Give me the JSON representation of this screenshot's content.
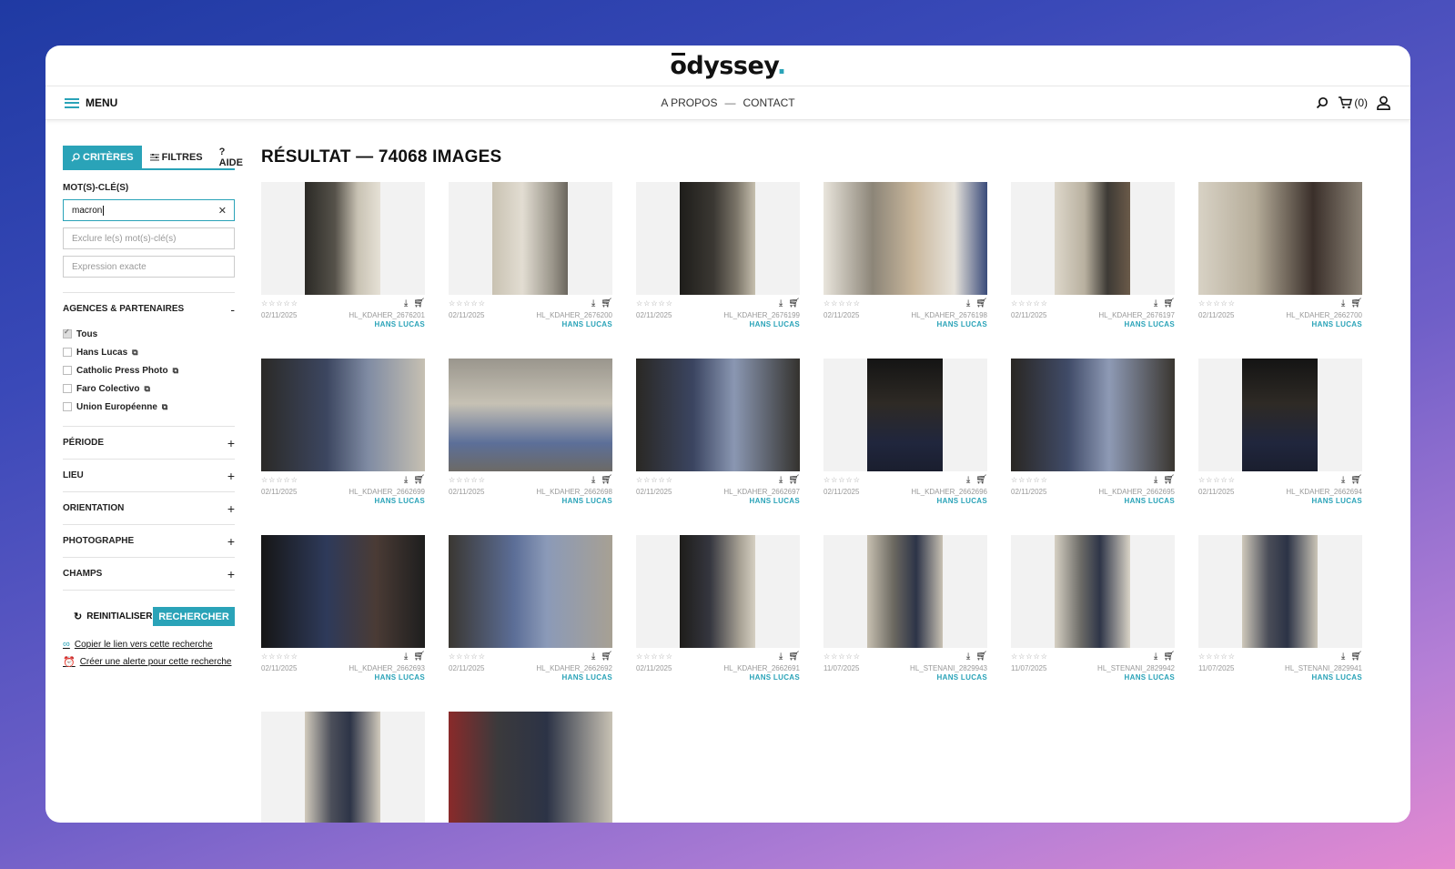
{
  "header": {
    "logo_text": "odyssey",
    "logo_dot": "."
  },
  "nav": {
    "menu_label": "MENU",
    "links": [
      "A PROPOS",
      "CONTACT"
    ],
    "separator": "—",
    "cart_count": "(0)"
  },
  "sidebar": {
    "tabs": [
      {
        "label": "CRITÈRES",
        "icon": "search-icon",
        "active": true
      },
      {
        "label": "FILTRES",
        "icon": "filters-icon",
        "active": false
      },
      {
        "label": "? AIDE",
        "icon": "help-icon",
        "active": false
      }
    ],
    "keywords_label": "MOT(S)-CLÉ(S)",
    "keyword_value": "macron",
    "exclude_placeholder": "Exclure le(s) mot(s)-clé(s)",
    "exact_placeholder": "Expression exacte",
    "agencies": {
      "label": "AGENCES & PARTENAIRES",
      "toggle": "-",
      "items": [
        {
          "label": "Tous",
          "checked": true,
          "external": false
        },
        {
          "label": "Hans Lucas",
          "checked": false,
          "external": true
        },
        {
          "label": "Catholic Press Photo",
          "checked": false,
          "external": true
        },
        {
          "label": "Faro Colectivo",
          "checked": false,
          "external": true
        },
        {
          "label": "Union Européenne",
          "checked": false,
          "external": true
        }
      ]
    },
    "sections": [
      {
        "label": "PÉRIODE",
        "toggle": "+"
      },
      {
        "label": "LIEU",
        "toggle": "+"
      },
      {
        "label": "ORIENTATION",
        "toggle": "+"
      },
      {
        "label": "PHOTOGRAPHE",
        "toggle": "+"
      },
      {
        "label": "CHAMPS",
        "toggle": "+"
      }
    ],
    "reset_label": "REINITIALISER",
    "search_label": "RECHERCHER",
    "copy_link_label": "Copier le lien vers cette recherche",
    "alert_label": "Créer une alerte pour cette recherche"
  },
  "results": {
    "title": "RÉSULTAT — 74068 IMAGES",
    "stars": "☆☆☆☆☆",
    "items": [
      {
        "date": "02/11/2025",
        "ref": "HL_KDAHER_2676201",
        "agency": "HANS LUCAS"
      },
      {
        "date": "02/11/2025",
        "ref": "HL_KDAHER_2676200",
        "agency": "HANS LUCAS"
      },
      {
        "date": "02/11/2025",
        "ref": "HL_KDAHER_2676199",
        "agency": "HANS LUCAS"
      },
      {
        "date": "02/11/2025",
        "ref": "HL_KDAHER_2676198",
        "agency": "HANS LUCAS"
      },
      {
        "date": "02/11/2025",
        "ref": "HL_KDAHER_2676197",
        "agency": "HANS LUCAS"
      },
      {
        "date": "02/11/2025",
        "ref": "HL_KDAHER_2662700",
        "agency": "HANS LUCAS"
      },
      {
        "date": "02/11/2025",
        "ref": "HL_KDAHER_2662699",
        "agency": "HANS LUCAS"
      },
      {
        "date": "02/11/2025",
        "ref": "HL_KDAHER_2662698",
        "agency": "HANS LUCAS"
      },
      {
        "date": "02/11/2025",
        "ref": "HL_KDAHER_2662697",
        "agency": "HANS LUCAS"
      },
      {
        "date": "02/11/2025",
        "ref": "HL_KDAHER_2662696",
        "agency": "HANS LUCAS"
      },
      {
        "date": "02/11/2025",
        "ref": "HL_KDAHER_2662695",
        "agency": "HANS LUCAS"
      },
      {
        "date": "02/11/2025",
        "ref": "HL_KDAHER_2662694",
        "agency": "HANS LUCAS"
      },
      {
        "date": "02/11/2025",
        "ref": "HL_KDAHER_2662693",
        "agency": "HANS LUCAS"
      },
      {
        "date": "02/11/2025",
        "ref": "HL_KDAHER_2662692",
        "agency": "HANS LUCAS"
      },
      {
        "date": "02/11/2025",
        "ref": "HL_KDAHER_2662691",
        "agency": "HANS LUCAS"
      },
      {
        "date": "11/07/2025",
        "ref": "HL_STENANI_2829943",
        "agency": "HANS LUCAS"
      },
      {
        "date": "11/07/2025",
        "ref": "HL_STENANI_2829942",
        "agency": "HANS LUCAS"
      },
      {
        "date": "11/07/2025",
        "ref": "HL_STENANI_2829941",
        "agency": "HANS LUCAS"
      },
      {
        "date": "",
        "ref": "",
        "agency": ""
      },
      {
        "date": "",
        "ref": "",
        "agency": ""
      }
    ]
  },
  "colors": {
    "accent": "#2aa3b8"
  }
}
